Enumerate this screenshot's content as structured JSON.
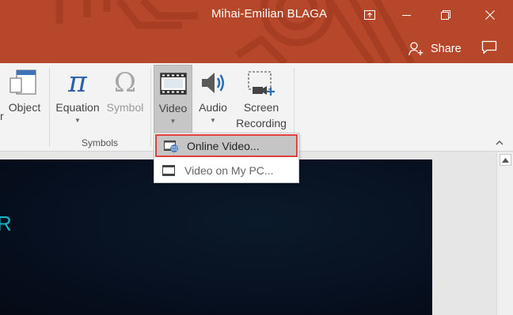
{
  "titlebar": {
    "user_name": "Mihai-Emilian BLAGA",
    "background_color": "#b7472a",
    "controls": {
      "restore_ribbon_icon": "ribbon-display-options-icon",
      "minimize_icon": "minimize-icon",
      "maximize_icon": "restore-down-icon",
      "close_icon": "close-icon"
    },
    "share_label": "Share",
    "comment_icon": "comment-icon"
  },
  "ribbon": {
    "object": {
      "label": "Object",
      "partial_prev_label": "r",
      "icon": "object-icon"
    },
    "equation": {
      "label": "Equation",
      "icon": "pi-icon"
    },
    "symbol": {
      "label": "Symbol",
      "icon": "omega-icon"
    },
    "symbols_group_label": "Symbols",
    "video": {
      "label": "Video",
      "icon": "film-icon"
    },
    "audio": {
      "label": "Audio",
      "icon": "speaker-icon"
    },
    "screen_recording": {
      "label_line1": "Screen",
      "label_line2": "Recording",
      "icon": "screen-recording-icon"
    }
  },
  "video_menu": {
    "items": [
      {
        "label": "Online Video...",
        "icon": "online-video-icon",
        "highlighted": true,
        "accent": "#e0403a"
      },
      {
        "label": "Video on My PC...",
        "icon": "video-file-icon",
        "highlighted": false
      }
    ]
  },
  "slide": {
    "visible_text": "R",
    "text_color": "#16b3c6"
  }
}
